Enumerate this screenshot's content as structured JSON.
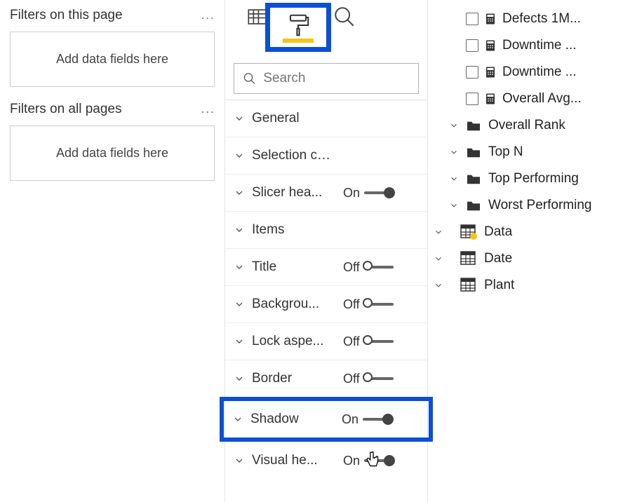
{
  "filters": {
    "page_label": "Filters on this page",
    "all_pages_label": "Filters on all pages",
    "drop_hint": "Add data fields here"
  },
  "format": {
    "search_placeholder": "Search",
    "items": [
      {
        "label": "General",
        "toggle": null
      },
      {
        "label": "Selection controls",
        "toggle": null
      },
      {
        "label": "Slicer hea...",
        "toggle": "On"
      },
      {
        "label": "Items",
        "toggle": null
      },
      {
        "label": "Title",
        "toggle": "Off"
      },
      {
        "label": "Backgrou...",
        "toggle": "Off"
      },
      {
        "label": "Lock aspe...",
        "toggle": "Off"
      },
      {
        "label": "Border",
        "toggle": "Off"
      },
      {
        "label": "Shadow",
        "toggle": "On"
      },
      {
        "label": "Visual he...",
        "toggle": "On"
      }
    ]
  },
  "fields": {
    "measures": [
      "Defects 1M...",
      "Downtime ...",
      "Downtime ...",
      "Overall Avg..."
    ],
    "folders": [
      "Overall Rank",
      "Top N",
      "Top Performing",
      "Worst Performing"
    ],
    "tables": [
      "Data",
      "Date",
      "Plant"
    ]
  }
}
